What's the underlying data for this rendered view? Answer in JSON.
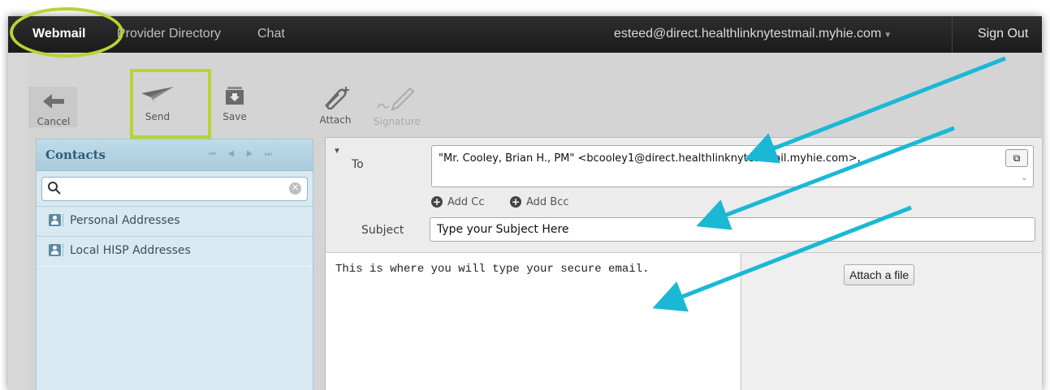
{
  "nav": {
    "webmail": "Webmail",
    "provider_directory": "Provider Directory",
    "chat": "Chat",
    "user": "esteed@direct.healthlinknytestmail.myhie.com",
    "sign_out": "Sign Out"
  },
  "toolbar": {
    "cancel": "Cancel",
    "send": "Send",
    "save": "Save",
    "attach": "Attach",
    "signature": "Signature"
  },
  "contacts": {
    "title": "Contacts",
    "search_placeholder": "",
    "items": [
      {
        "label": "Personal Addresses"
      },
      {
        "label": "Local HISP Addresses"
      }
    ]
  },
  "compose": {
    "to_label": "To",
    "to_value": "\"Mr. Cooley, Brian H., PM\" <bcooley1@direct.healthlinknytestmail.myhie.com>,",
    "add_cc": "Add Cc",
    "add_bcc": "Add Bcc",
    "subject_label": "Subject",
    "subject_value": "Type your Subject Here",
    "body_text": "This is where you will type your secure email.",
    "attach_file": "Attach a file"
  },
  "colors": {
    "highlight": "#b8d432",
    "arrow": "#1bb8d6",
    "nav_bg": "#222222",
    "contacts_bg": "#d8e9f1"
  },
  "icons": [
    "back-arrow-icon",
    "paper-plane-icon",
    "save-tray-icon",
    "paperclip-icon",
    "pen-icon",
    "search-icon",
    "clear-icon",
    "contact-card-icon",
    "popout-icon",
    "plus-circle-icon",
    "collapse-triangle-icon"
  ]
}
